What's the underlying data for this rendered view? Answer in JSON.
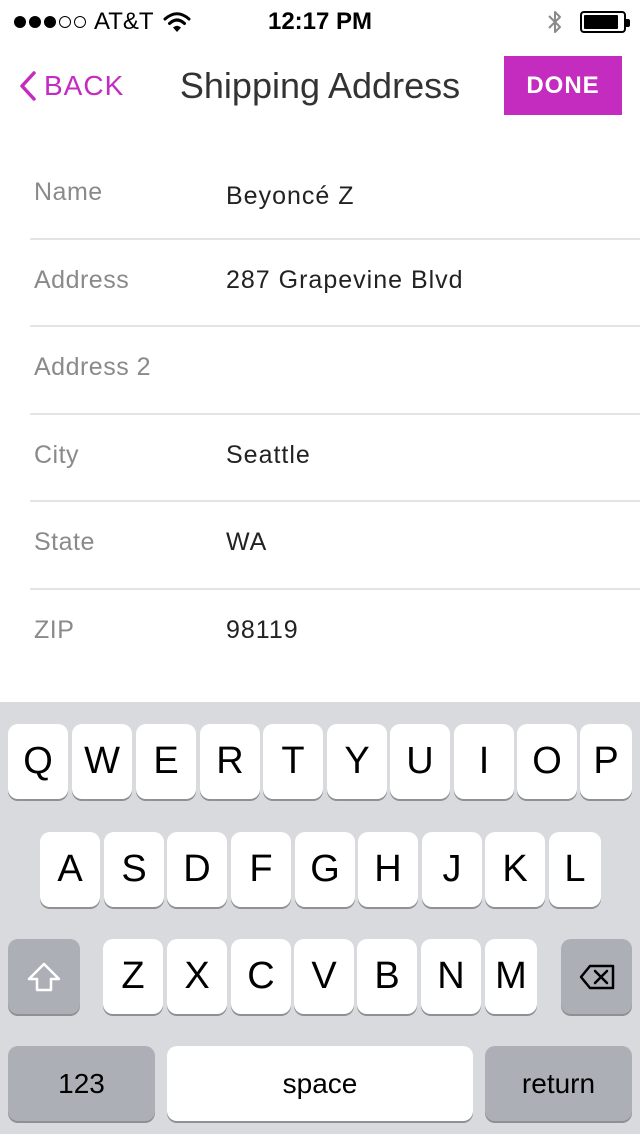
{
  "status_bar": {
    "carrier": "AT&T",
    "time": "12:17 PM",
    "signal_bars": [
      true,
      true,
      true,
      false,
      false
    ],
    "battery_level": 0.9
  },
  "nav": {
    "back_label": "BACK",
    "title": "Shipping Address",
    "done_label": "DONE",
    "accent_color": "#c42cc0"
  },
  "form": {
    "fields": [
      {
        "label": "Name",
        "value": "Beyoncé Z"
      },
      {
        "label": "Address",
        "value": "287 Grapevine Blvd"
      },
      {
        "label": "Address 2",
        "value": ""
      },
      {
        "label": "City",
        "value": "Seattle"
      },
      {
        "label": "State",
        "value": "WA"
      },
      {
        "label": "ZIP",
        "value": "98119"
      }
    ]
  },
  "keyboard": {
    "row1": [
      "Q",
      "W",
      "E",
      "R",
      "T",
      "Y",
      "U",
      "I",
      "O",
      "P"
    ],
    "row2": [
      "A",
      "S",
      "D",
      "F",
      "G",
      "H",
      "J",
      "K",
      "L"
    ],
    "row3": [
      "Z",
      "X",
      "C",
      "V",
      "B",
      "N",
      "M"
    ],
    "numbers_label": "123",
    "space_label": "space",
    "return_label": "return"
  }
}
